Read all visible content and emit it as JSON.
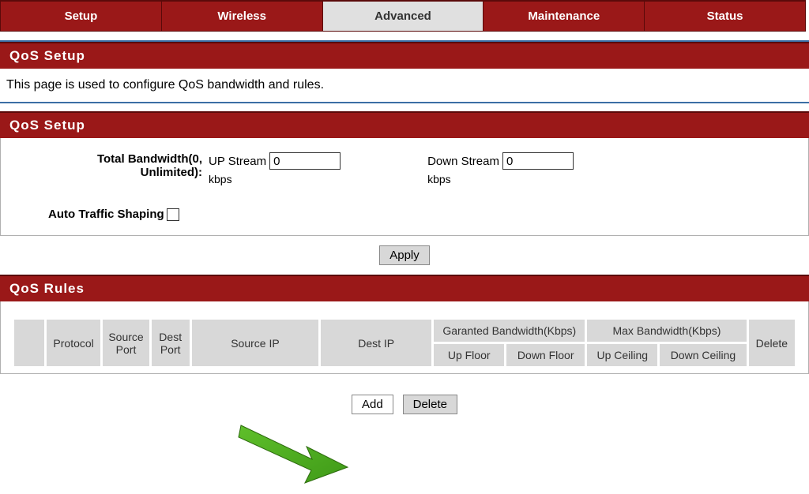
{
  "tabs": {
    "setup": "Setup",
    "wireless": "Wireless",
    "advanced": "Advanced",
    "maintenance": "Maintenance",
    "status": "Status"
  },
  "section1": {
    "title": "QoS Setup",
    "description": "This page is used to configure QoS bandwidth and rules."
  },
  "section2": {
    "title": "QoS Setup",
    "total_bw_label1": "Total Bandwidth(0,",
    "total_bw_label2": "Unlimited):",
    "up_label": "UP Stream",
    "up_value": "0",
    "up_unit": "kbps",
    "down_label": "Down Stream",
    "down_value": "0",
    "down_unit": "kbps",
    "ats_label": "Auto Traffic Shaping",
    "apply": "Apply"
  },
  "section3": {
    "title": "QoS Rules",
    "cols": {
      "blank": "",
      "protocol": "Protocol",
      "src_port": "Source Port",
      "dst_port": "Dest Port",
      "src_ip": "Source IP",
      "dst_ip": "Dest IP",
      "gbw": "Garanted Bandwidth(Kbps)",
      "mbw": "Max Bandwidth(Kbps)",
      "delete": "Delete",
      "up_floor": "Up Floor",
      "down_floor": "Down Floor",
      "up_ceil": "Up Ceiling",
      "down_ceil": "Down Ceiling"
    },
    "add": "Add",
    "delete_btn": "Delete"
  }
}
